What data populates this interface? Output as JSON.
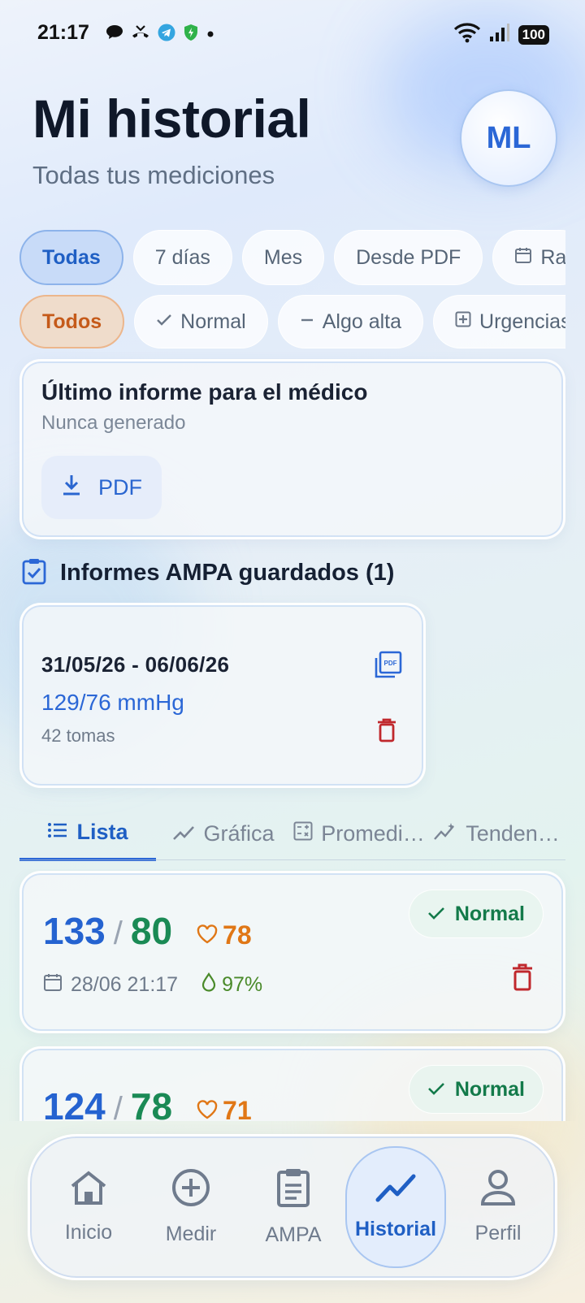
{
  "status_bar": {
    "time": "21:17",
    "battery": "100",
    "icons": [
      "chat-bubble-icon",
      "missed-call-icon",
      "telegram-icon",
      "shield-icon",
      "dot-icon",
      "wifi-icon",
      "signal-icon"
    ]
  },
  "header": {
    "title": "Mi historial",
    "subtitle": "Todas tus mediciones",
    "avatar_initials": "ML"
  },
  "period_filters": [
    {
      "label": "Todas",
      "active": true
    },
    {
      "label": "7 días",
      "active": false
    },
    {
      "label": "Mes",
      "active": false
    },
    {
      "label": "Desde PDF",
      "active": false
    },
    {
      "label": "Ra",
      "active": false,
      "icon": "calendar-icon"
    }
  ],
  "status_filters": [
    {
      "label": "Todos",
      "active": true
    },
    {
      "label": "Normal",
      "icon": "check-icon"
    },
    {
      "label": "Algo alta",
      "icon": "minus-icon"
    },
    {
      "label": "Urgencias",
      "icon": "plus-box-icon"
    }
  ],
  "report": {
    "title": "Último informe para el médico",
    "subtitle": "Nunca generado",
    "button_label": "PDF"
  },
  "ampa_section": {
    "title": "Informes AMPA guardados (1)",
    "reports": [
      {
        "range": "31/05/26 - 06/06/26",
        "bp": "129/76 mmHg",
        "count": "42 tomas"
      }
    ]
  },
  "tabs": [
    {
      "label": "Lista",
      "icon": "list-icon",
      "active": true
    },
    {
      "label": "Gráfica",
      "icon": "chart-line-icon"
    },
    {
      "label": "Promedi…",
      "icon": "calculator-icon"
    },
    {
      "label": "Tenden…",
      "icon": "trend-icon"
    }
  ],
  "measurements": [
    {
      "systolic": "133",
      "diastolic": "80",
      "heart_rate": "78",
      "date": "28/06 21:17",
      "spo2": "97%",
      "status": "Normal"
    },
    {
      "systolic": "124",
      "diastolic": "78",
      "heart_rate": "71",
      "status": "Normal"
    }
  ],
  "bottom_nav": [
    {
      "label": "Inicio",
      "icon": "home-icon"
    },
    {
      "label": "Medir",
      "icon": "plus-circle-icon"
    },
    {
      "label": "AMPA",
      "icon": "clipboard-icon"
    },
    {
      "label": "Historial",
      "icon": "trend-line-icon",
      "active": true
    },
    {
      "label": "Perfil",
      "icon": "person-icon"
    }
  ],
  "colors": {
    "accent_blue": "#2b67d6",
    "normal_green": "#137a4a",
    "heart_orange": "#e07716",
    "delete_red": "#c0282d",
    "filter_orange": "#c55a1a"
  }
}
